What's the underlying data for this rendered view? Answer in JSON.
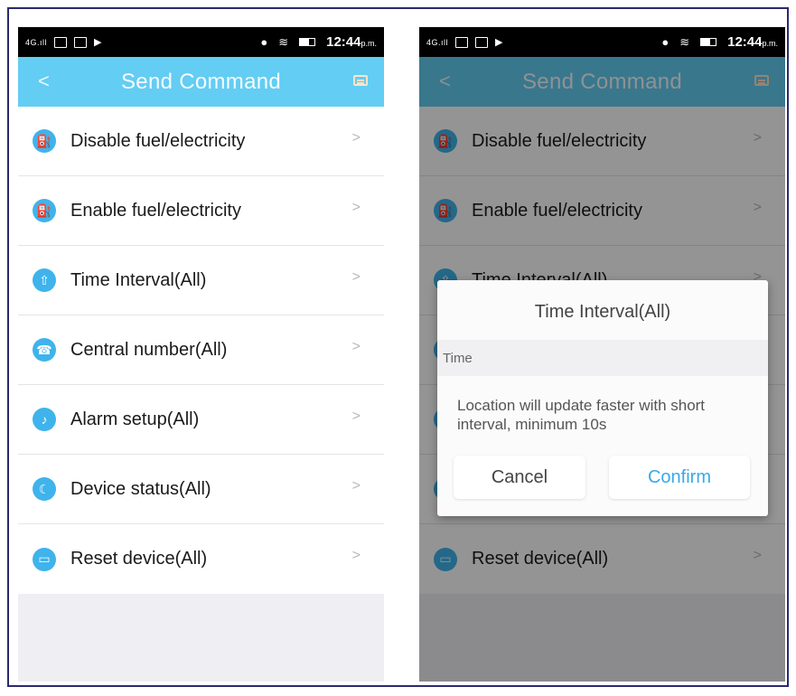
{
  "status_bar": {
    "network": "4G",
    "time": "12:44",
    "time_suffix": "p.m."
  },
  "header": {
    "title": "Send Command",
    "back_icon": "chevron-left-icon",
    "action_icon": "chat-icon"
  },
  "menu": {
    "items": [
      {
        "label": "Disable fuel/electricity",
        "icon": "fuel-disable-icon"
      },
      {
        "label": "Enable fuel/electricity",
        "icon": "fuel-enable-icon"
      },
      {
        "label": "Time Interval(All)",
        "icon": "upload-icon"
      },
      {
        "label": "Central number(All)",
        "icon": "phone-icon"
      },
      {
        "label": "Alarm setup(All)",
        "icon": "bell-icon"
      },
      {
        "label": "Device status(All)",
        "icon": "moon-icon"
      },
      {
        "label": "Reset device(All)",
        "icon": "monitor-icon"
      }
    ],
    "chevron": ">"
  },
  "dialog": {
    "title": "Time Interval(All)",
    "input_placeholder": "Time",
    "message": "Location will update faster with short interval, minimum 10s",
    "cancel_label": "Cancel",
    "confirm_label": "Confirm"
  },
  "colors": {
    "accent": "#63cdf3",
    "icon": "#3fb3ec",
    "confirm": "#3aa9e6"
  }
}
